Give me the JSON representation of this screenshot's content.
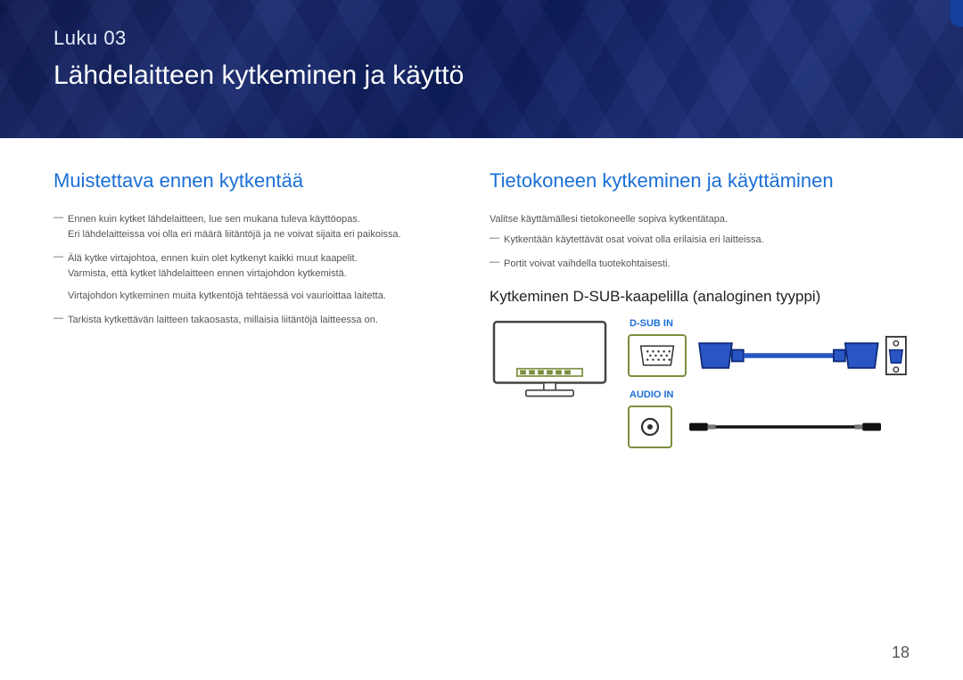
{
  "header": {
    "chapter_label": "Luku 03",
    "chapter_title": "Lähdelaitteen kytkeminen ja käyttö"
  },
  "left": {
    "heading": "Muistettava ennen kytkentää",
    "notes": [
      {
        "a": "Ennen kuin kytket lähdelaitteen, lue sen mukana tuleva käyttöopas.",
        "b": "Eri lähdelaitteissa voi olla eri määrä liitäntöjä ja ne voivat sijaita eri paikoissa."
      },
      {
        "a": "Älä kytke virtajohtoa, ennen kuin olet kytkenyt kaikki muut kaapelit.",
        "b": "Varmista, että kytket lähdelaitteen ennen virtajohdon kytkemistä.",
        "c": "Virtajohdon kytkeminen muita kytkentöjä tehtäessä voi vaurioittaa laitetta."
      },
      {
        "a": "Tarkista kytkettävän laitteen takaosasta, millaisia liitäntöjä laitteessa on."
      }
    ]
  },
  "right": {
    "heading": "Tietokoneen kytkeminen ja käyttäminen",
    "intro": "Valitse käyttämällesi tietokoneelle sopiva kytkentätapa.",
    "notes": [
      "Kytkentään käytettävät osat voivat olla erilaisia eri laitteissa.",
      "Portit voivat vaihdella tuotekohtaisesti."
    ],
    "sub_heading": "Kytkeminen D-SUB-kaapelilla (analoginen tyyppi)",
    "labels": {
      "dsub": "D-SUB IN",
      "audio": "AUDIO IN"
    }
  },
  "footer": {
    "page": "18"
  }
}
